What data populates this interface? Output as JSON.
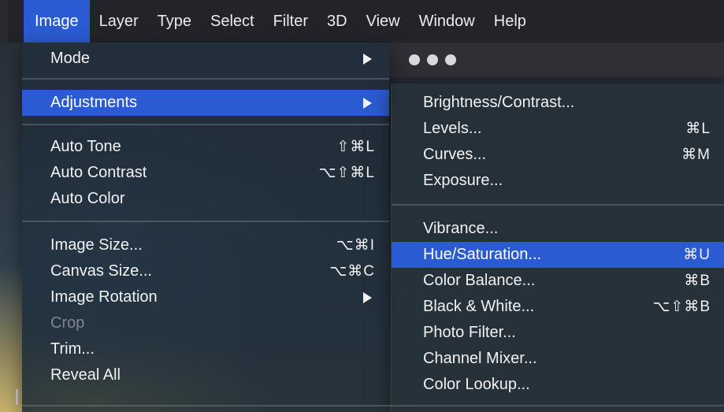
{
  "menubar": {
    "items": [
      {
        "label": "Image",
        "active": true
      },
      {
        "label": "Layer"
      },
      {
        "label": "Type"
      },
      {
        "label": "Select"
      },
      {
        "label": "Filter"
      },
      {
        "label": "3D"
      },
      {
        "label": "View"
      },
      {
        "label": "Window"
      },
      {
        "label": "Help"
      }
    ]
  },
  "image_menu": {
    "items": [
      {
        "label": "Mode",
        "submenu": true
      },
      {
        "label": "Adjustments",
        "submenu": true,
        "highlighted": true
      },
      {
        "label": "Auto Tone",
        "shortcut": "⇧⌘L"
      },
      {
        "label": "Auto Contrast",
        "shortcut": "⌥⇧⌘L"
      },
      {
        "label": "Auto Color"
      },
      {
        "label": "Image Size...",
        "shortcut": "⌥⌘I"
      },
      {
        "label": "Canvas Size...",
        "shortcut": "⌥⌘C"
      },
      {
        "label": "Image Rotation",
        "submenu": true
      },
      {
        "label": "Crop",
        "disabled": true
      },
      {
        "label": "Trim..."
      },
      {
        "label": "Reveal All"
      }
    ]
  },
  "adjustments_menu": {
    "items": [
      {
        "label": "Brightness/Contrast..."
      },
      {
        "label": "Levels...",
        "shortcut": "⌘L"
      },
      {
        "label": "Curves...",
        "shortcut": "⌘M"
      },
      {
        "label": "Exposure..."
      },
      {
        "label": "Vibrance..."
      },
      {
        "label": "Hue/Saturation...",
        "shortcut": "⌘U",
        "highlighted": true
      },
      {
        "label": "Color Balance...",
        "shortcut": "⌘B"
      },
      {
        "label": "Black & White...",
        "shortcut": "⌥⇧⌘B"
      },
      {
        "label": "Photo Filter..."
      },
      {
        "label": "Channel Mixer..."
      },
      {
        "label": "Color Lookup..."
      }
    ]
  },
  "colors": {
    "highlight": "#2b5bd2",
    "menubar_bg": "#23242a",
    "text": "#f2f2f2",
    "disabled_text": "#7e8691"
  }
}
